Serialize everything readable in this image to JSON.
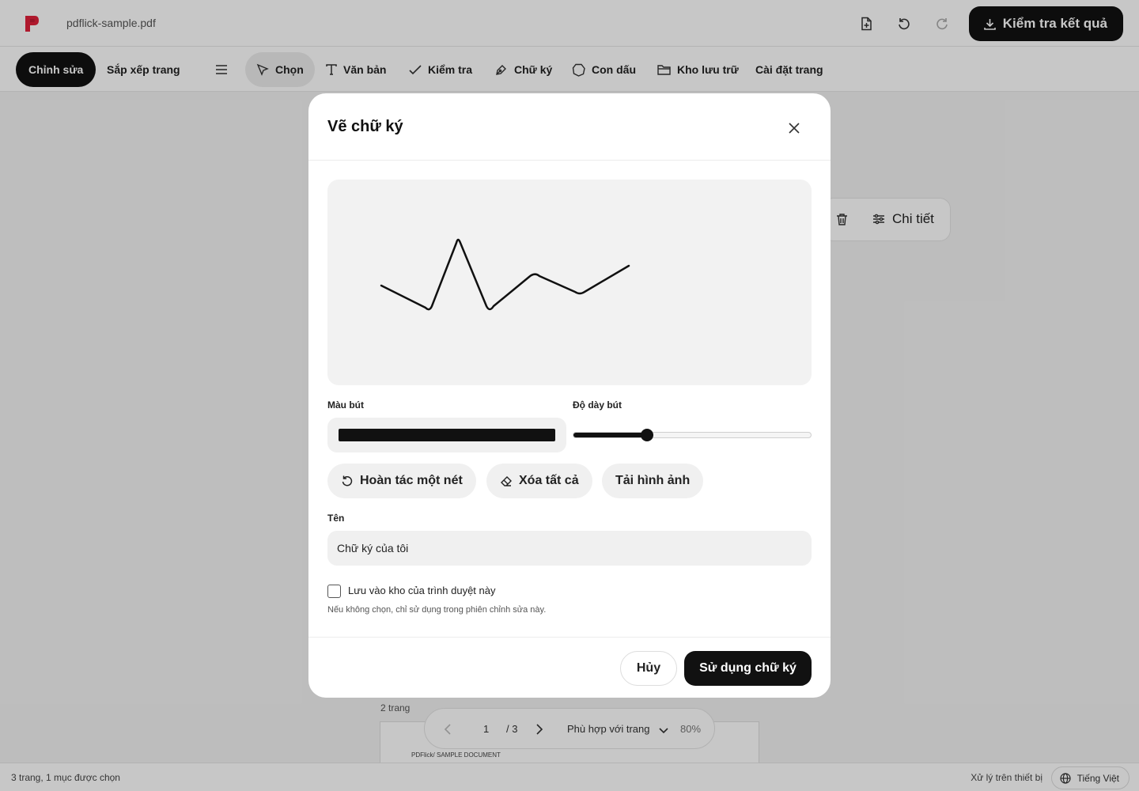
{
  "app": {
    "filename": "pdflick-sample.pdf",
    "brand_color": "#e0203a",
    "export_label": "Kiểm tra kết quả"
  },
  "toolbar": {
    "edit_tab": "Chỉnh sửa",
    "arrange_tab": "Sắp xếp trang",
    "select": "Chọn",
    "text": "Văn bản",
    "check": "Kiểm tra",
    "signature": "Chữ ký",
    "stamp": "Con dấu",
    "storage": "Kho lưu trữ",
    "page_settings": "Cài đặt trang"
  },
  "float_panel": {
    "details": "Chi tiết"
  },
  "document": {
    "pages_label": "2 trang",
    "thumb_header": "PDFlick/ SAMPLE DOCUMENT"
  },
  "pager": {
    "current_page": "1",
    "total": "/ 3",
    "fit_mode": "Phù hợp với trang",
    "zoom": "80%"
  },
  "status": {
    "left": "3 trang, 1 mục được chọn",
    "processing": "Xử lý trên thiết bị",
    "language": "Tiếng Việt"
  },
  "modal": {
    "title": "Vẽ chữ ký",
    "pen_color_label": "Màu bút",
    "pen_color": "#111111",
    "pen_width_label": "Độ dày bút",
    "pen_width_fraction": 0.31,
    "undo_stroke": "Hoàn tác một nét",
    "clear_all": "Xóa tất cả",
    "upload_image": "Tải hình ảnh",
    "name_label": "Tên",
    "name_value": "Chữ ký của tôi",
    "save_checkbox_label": "Lưu vào kho của trình duyệt này",
    "save_checked": false,
    "hint": "Nếu không chọn, chỉ sử dụng trong phiên chỉnh sửa này.",
    "cancel": "Hủy",
    "use_signature": "Sử dụng chữ ký"
  }
}
